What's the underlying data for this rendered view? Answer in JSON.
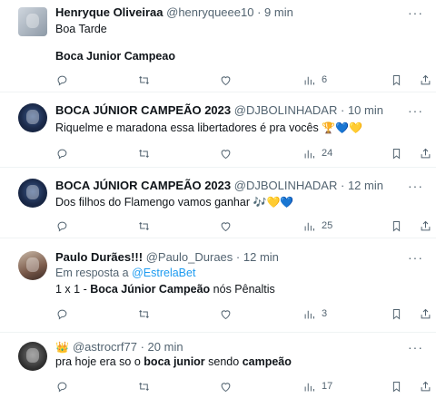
{
  "tweets": [
    {
      "name": "Henryque Oliveiraa",
      "handle": "@henryqueee10",
      "sep": "·",
      "time": "9 min",
      "line1": "Boa Tarde",
      "line2": "Boca Junior Campeao",
      "views": "6"
    },
    {
      "name": "BOCA JÚNIOR CAMPEÃO 2023",
      "handle": "@DJBOLINHADAR",
      "sep": "·",
      "time": "10 min",
      "text": "Riquelme e maradona essa libertadores é pra vocês",
      "emojis": "🏆💙💛",
      "views": "24"
    },
    {
      "name": "BOCA JÚNIOR CAMPEÃO 2023",
      "handle": "@DJBOLINHADAR",
      "sep": "·",
      "time": "12 min",
      "text": "Dos filhos do Flamengo vamos ganhar",
      "emojis": "🎶💛💙",
      "views": "25"
    },
    {
      "name": "Paulo Durães!!!",
      "handle": "@Paulo_Duraes",
      "sep": "·",
      "time": "12 min",
      "reply_prefix": "Em resposta a",
      "reply_to": "@EstrelaBet",
      "text_a": "1 x 1 - ",
      "text_b": "Boca Júnior Campeão",
      "text_c": " nós Pênaltis",
      "views": "3"
    },
    {
      "name": "👑",
      "handle": "@astrocrf77",
      "sep": "·",
      "time": "20 min",
      "text_a": "pra hoje era so o ",
      "text_b": "boca junior",
      "text_c": " sendo ",
      "text_d": "campeão",
      "views": "17"
    }
  ],
  "more_label": "···",
  "icons": {
    "reply": "reply-icon",
    "retweet": "retweet-icon",
    "like": "like-icon",
    "views": "views-icon",
    "bookmark": "bookmark-icon",
    "share": "share-icon"
  }
}
